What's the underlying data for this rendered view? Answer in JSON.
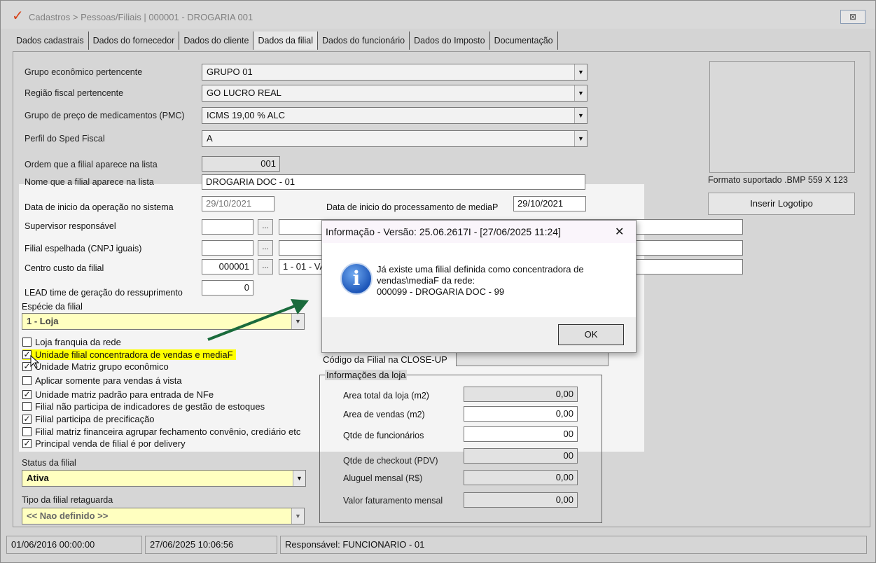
{
  "window": {
    "title": "Cadastros > Pessoas/Filiais | 000001 - DROGARIA 001",
    "close_label": "⊠"
  },
  "tabs": [
    {
      "label": "Dados cadastrais"
    },
    {
      "label": "Dados do fornecedor"
    },
    {
      "label": "Dados do cliente"
    },
    {
      "label": "Dados da filial"
    },
    {
      "label": "Dados do funcionário"
    },
    {
      "label": "Dados do Imposto"
    },
    {
      "label": "Documentação"
    }
  ],
  "form": {
    "grupo_economico": {
      "label": "Grupo econômico pertencente",
      "value": "GRUPO 01"
    },
    "regiao_fiscal": {
      "label": "Região fiscal pertencente",
      "value": "GO LUCRO REAL"
    },
    "grupo_preco": {
      "label": "Grupo de preço de medicamentos (PMC)",
      "value": "ICMS 19,00 % ALC"
    },
    "perfil_sped": {
      "label": "Perfil do Sped Fiscal",
      "value": "A"
    },
    "ordem": {
      "label": "Ordem que a filial aparece na lista",
      "value": "001"
    },
    "nome_lista": {
      "label": "Nome que a filial aparece na lista",
      "value": "DROGARIA DOC - 01"
    },
    "data_inicio_op": {
      "label": "Data de inicio da operação no sistema",
      "value": "29/10/2021"
    },
    "data_inicio_proc": {
      "label": "Data de inicio do processamento de mediaP",
      "value": "29/10/2021"
    },
    "supervisor": {
      "label": "Supervisor responsável",
      "value": ""
    },
    "filial_espelhada": {
      "label": "Filial espelhada (CNPJ iguais)",
      "value": ""
    },
    "centro_custo": {
      "label": "Centro custo da filial",
      "value": "000001",
      "desc": "1 - 01 - VA"
    },
    "lead_time": {
      "label": "LEAD time de geração do ressuprimento",
      "value": "0"
    },
    "especie": {
      "label": "Espécie da filial",
      "value": "1 - Loja"
    },
    "status": {
      "label": "Status da filial",
      "value": "Ativa"
    },
    "tipo_retaguarda": {
      "label": "Tipo da filial retaguarda",
      "value": "<< Nao definido >>"
    },
    "codigo_closeup": {
      "label": "Código da Filial na CLOSE-UP",
      "value": ""
    },
    "dots_label": "..."
  },
  "checkboxes": [
    {
      "label": "Loja franquia da rede",
      "checked": false
    },
    {
      "label": "Unidade filial concentradora de vendas e mediaF",
      "checked": true
    },
    {
      "label": "Unidade Matriz grupo econômico",
      "checked": true
    },
    {
      "label": "Aplicar somente para vendas á vista",
      "checked": false
    },
    {
      "label": "Unidade matriz padrão para entrada de NFe",
      "checked": true
    },
    {
      "label": "Filial não participa de indicadores de gestão de estoques",
      "checked": false
    },
    {
      "label": "Filial participa de precificação",
      "checked": true
    },
    {
      "label": "Filial matriz financeira agrupar fechamento convênio, crediário etc",
      "checked": false
    },
    {
      "label": "Principal venda de filial é por delivery",
      "checked": true
    }
  ],
  "logo": {
    "format_label": "Formato suportado .BMP 559 X 123",
    "button_label": "Inserir Logotipo"
  },
  "loja": {
    "title": "Informações da loja",
    "fields": [
      {
        "label": "Area total da loja (m2)",
        "value": "0,00"
      },
      {
        "label": "Area de vendas (m2)",
        "value": "0,00"
      },
      {
        "label": "Qtde de funcionários",
        "value": "00"
      },
      {
        "label": "Qtde de checkout (PDV)",
        "value": "00"
      },
      {
        "label": "Aluguel mensal (R$)",
        "value": "0,00"
      },
      {
        "label": "Valor faturamento mensal",
        "value": "0,00"
      }
    ]
  },
  "statusbar": {
    "created": "01/06/2016 00:00:00",
    "modified": "27/06/2025 10:06:56",
    "responsavel": "Responsável: FUNCIONARIO - 01"
  },
  "dialog": {
    "title": "Informação - Versão: 25.06.2617I - [27/06/2025 11:24]",
    "close_label": "✕",
    "icon_label": "i",
    "message": "Já existe uma filial definida como concentradora de\nvendas\\mediaF da rede:\n000099 - DROGARIA DOC - 99",
    "ok_label": "OK"
  },
  "colors": {
    "highlight": "#ffff00",
    "arrow": "#1a6b3c",
    "app_logo": "#d64219"
  }
}
